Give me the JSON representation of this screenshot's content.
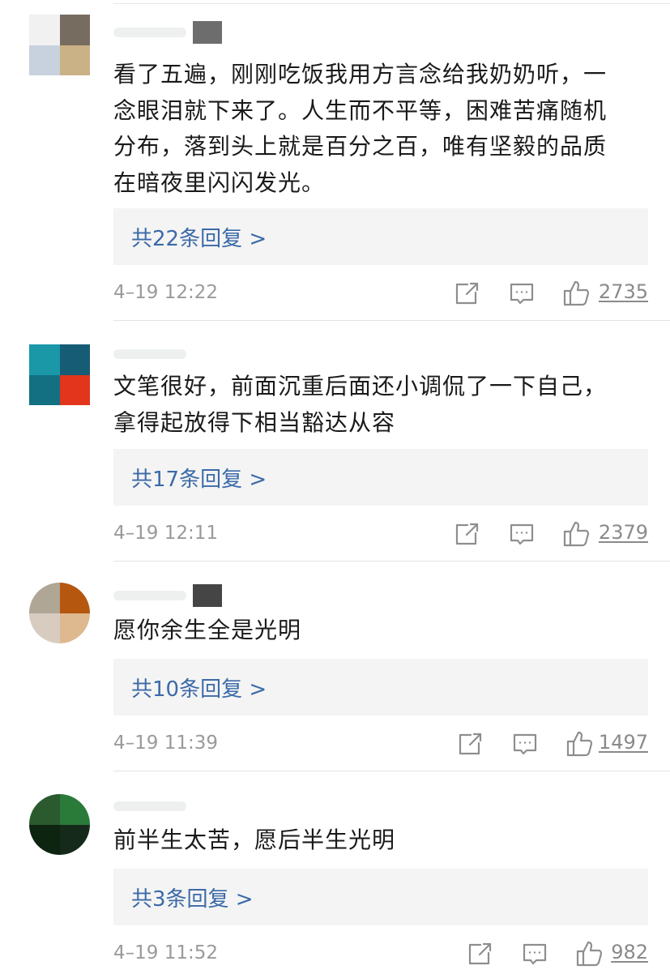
{
  "comments": [
    {
      "avatar_colors": [
        "#f1f1f1",
        "#776c60",
        "#c7d2de",
        "#cbb186"
      ],
      "username_block_color": "#6d6d6d",
      "lines": [
        "看了五遍，刚刚吃饭我用方言念给我奶奶听，一",
        "念眼泪就下来了。人生而不平等，困难苦痛随机",
        "分布，落到头上就是百分之百，唯有坚毅的品质",
        "在暗夜里闪闪发光。"
      ],
      "reply_label": "共22条回复 >",
      "timestamp": "4–19 12:22",
      "likes": "2735"
    },
    {
      "avatar_colors": [
        "#1a98a8",
        "#155c74",
        "#137082",
        "#e2351b"
      ],
      "username_block_color": "#ffffff",
      "lines": [
        "文笔很好，前面沉重后面还小调侃了一下自己，",
        "拿得起放得下相当豁达从容"
      ],
      "reply_label": "共17条回复 >",
      "timestamp": "4–19 12:11",
      "likes": "2379"
    },
    {
      "avatar_colors": [
        "#b0a696",
        "#b5570f",
        "#d8ccc0",
        "#deb98f"
      ],
      "username_block_color": "#454545",
      "lines": [
        "愿你余生全是光明"
      ],
      "reply_label": "共10条回复 >",
      "timestamp": "4–19 11:39",
      "likes": "1497"
    },
    {
      "avatar_colors": [
        "#2a5a2e",
        "#2a7a3a",
        "#0d2410",
        "#162a1c"
      ],
      "username_block_color": "#ffffff",
      "lines": [
        "前半生太苦，愿后半生光明"
      ],
      "reply_label": "共3条回复 >",
      "timestamp": "4–19 11:52",
      "likes": "982"
    }
  ],
  "icons": {
    "share": "share-icon",
    "comment": "comment-icon",
    "like": "thumbs-up-icon"
  }
}
